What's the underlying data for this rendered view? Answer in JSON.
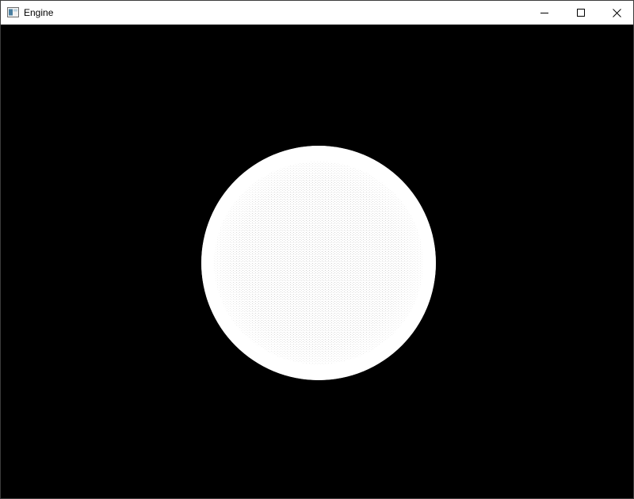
{
  "window": {
    "title": "Engine",
    "app_icon": "application-window-icon",
    "controls": {
      "minimize_icon": "minimize-icon",
      "maximize_icon": "maximize-icon",
      "close_icon": "close-icon"
    }
  },
  "viewport": {
    "background_color": "#000000",
    "object": "sphere",
    "object_color": "#ffffff"
  }
}
